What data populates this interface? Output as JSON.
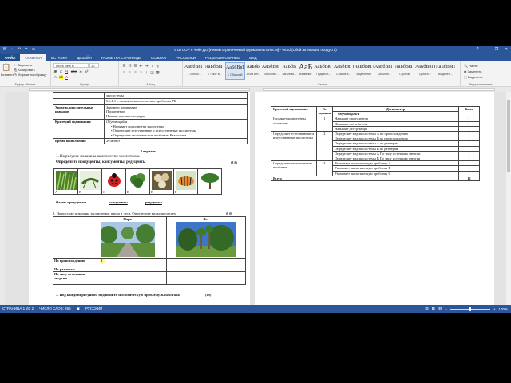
{
  "window": {
    "title": "5 сн СОР 6 чейн ДО [Режим ограниченной функциональности] - Word (Сбой активации продукта)",
    "quick_access": [
      "save-icon",
      "undo-icon",
      "redo-icon",
      "print-icon"
    ],
    "controls": [
      "?",
      "—",
      "❐",
      "✕"
    ]
  },
  "ribbon_tabs": {
    "file": "ФАЙЛ",
    "items": [
      "ГЛАВНАЯ",
      "ВСТАВКА",
      "ДИЗАЙН",
      "РАЗМЕТКА СТРАНИЦЫ",
      "ССЫЛКИ",
      "РАССЫЛКИ",
      "РЕЦЕНЗИРОВАНИЕ",
      "ВИД"
    ],
    "active": "ГЛАВНАЯ"
  },
  "ribbon": {
    "clipboard": {
      "paste": "Вставить",
      "cut": "Вырезать",
      "copy": "Копировать",
      "format": "Формат по образцу",
      "label": "Буфер обмена"
    },
    "font": {
      "name": "Times New R",
      "size": "10",
      "label": "Шрифт",
      "fmt": [
        "Ж",
        "К",
        "Ч",
        "abc",
        "x₂",
        "x²"
      ]
    },
    "paragraph": {
      "label": "Абзац"
    },
    "styles": {
      "label": "Стили",
      "items": [
        {
          "sample": "АаБбВвГг",
          "name": "1 Заголо..."
        },
        {
          "sample": "АаБбВвГг",
          "name": "1 Текст в..."
        },
        {
          "sample": "АаБбВвГг",
          "name": "1 Обычный"
        },
        {
          "sample": "АаБбВ",
          "name": "1 Без инт..."
        },
        {
          "sample": "АаБбВвГ",
          "name": "Заголово..."
        },
        {
          "sample": "АаБбВ",
          "name": "Заголово..."
        },
        {
          "sample": "АаБ",
          "name": "Название"
        },
        {
          "sample": "АаБбВвГ",
          "name": "Подзагол..."
        },
        {
          "sample": "АаБбВвГг",
          "name": "Слабое в..."
        },
        {
          "sample": "АаБбВвГг",
          "name": "Выделение"
        },
        {
          "sample": "АаБбВвГг",
          "name": "Сильное..."
        },
        {
          "sample": "АаБбВвГг",
          "name": "Строгий"
        },
        {
          "sample": "АаБбВвГг",
          "name": "Цитата 2"
        },
        {
          "sample": "АаБбВвГг",
          "name": "Выделен..."
        }
      ]
    },
    "editing": {
      "find": "Найти",
      "replace": "Заменить",
      "select": "Выделить",
      "label": "Редактирование"
    }
  },
  "page1": {
    "top_table": [
      {
        "k": "",
        "v": [
          "экосистемы"
        ]
      },
      {
        "k": "",
        "v": [
          "5.6.1.1 – называть экологические проблемы РК"
        ]
      },
      {
        "k": "Уровень мыслительных навыков",
        "v": [
          "Знание и понимание",
          "Применение",
          "Навыки высокого порядка"
        ]
      },
      {
        "k": "Критерий оценивания",
        "v": [
          "Обучающийся",
          "• Называет компоненты экосистемы",
          "• Определяет естественные и искусственные экосистемы",
          "• Определяет экологические проблемы Казахстана"
        ]
      },
      {
        "k": "Время выполнения",
        "v": [
          "20 минут"
        ]
      }
    ],
    "variant": "2 вариант",
    "q1": "1.  На рисунке показаны компоненты экосистемы.",
    "q1b_pre": "Определите  ",
    "q1b_words": "продуценты, консументы, редуценты",
    "q1_points": "(3 б)",
    "pic_labels": [
      "A",
      "B",
      "C",
      "D",
      "E",
      "F"
    ],
    "answer_line": {
      "producers": "Ответ: продуценты",
      "blank1": "______",
      "consumers": "консументы",
      "blank2": "______",
      "reducers": "редуценты",
      "blank3": "______"
    },
    "q2": "2. На рисунке показаны экосистемы: парка и леса. Определите виды экосистем",
    "q2_points": "(6 б)",
    "park_table": {
      "headers": [
        "Парк",
        "Лес"
      ],
      "rows": [
        "По происхождению",
        "По размерам",
        "По типу источника энергии"
      ]
    },
    "q3": "3.  Под каждым рисунком подпишите экологическую проблему Казахстана",
    "q3_points": "(3 б)"
  },
  "page2": {
    "headers": [
      "Критерий оценивания",
      "№ задания",
      "Дескриптор",
      "Балл"
    ],
    "sub": "Обучающийся",
    "groups": [
      {
        "crit": "Называет компоненты экосистем",
        "num": "1",
        "rows": [
          [
            "Называет продуцентов",
            "1"
          ],
          [
            "Называет потребителя",
            "1"
          ],
          [
            "Называет деструктора",
            "1"
          ]
        ]
      },
      {
        "crit": "Определяет естественные и искусственные экосистемы",
        "num": "2",
        "rows": [
          [
            "Определяет вид экосистемы А по происхождению",
            "1"
          ],
          [
            "Определяет вид экосистемы В по происхождению",
            "1"
          ],
          [
            "Определяет вид экосистемы А по размерам",
            "1"
          ],
          [
            "Определяет вид экосистемы В по размерам",
            "1"
          ],
          [
            "Определяет вид экосистемы А По типу источника энергии",
            "1"
          ],
          [
            "Определяет вид экосистемы В По типу источника энергии",
            "1"
          ]
        ]
      },
      {
        "crit": "Определяет экологические проблемы",
        "num": "3",
        "rows": [
          [
            "Указывает экологическую проблему А",
            "1"
          ],
          [
            "Указывает экологическую проблему В",
            "1"
          ],
          [
            "Указывает экологическую проблему С",
            "1"
          ]
        ]
      }
    ],
    "total_label": "Всего",
    "total": "12"
  },
  "status": {
    "page": "СТРАНИЦА 1 ИЗ 2",
    "words": "ЧИСЛО СЛОВ: 266",
    "lang": "РУССКИЙ",
    "zoom": "100%"
  },
  "colors": {
    "accent": "#2b579a"
  }
}
